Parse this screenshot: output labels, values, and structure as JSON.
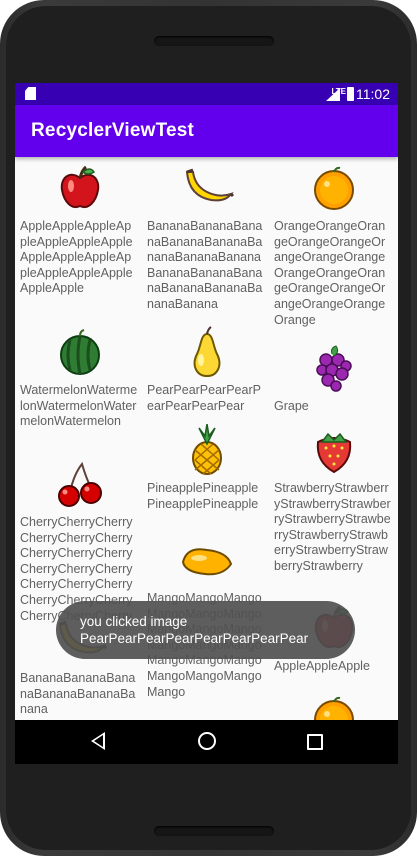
{
  "status_bar": {
    "time": "11:02",
    "network": "LTE"
  },
  "app_bar": {
    "title": "RecyclerViewTest"
  },
  "columns": [
    [
      {
        "fruit": "apple",
        "name": "AppleAppleAppleAppleAppleAppleAppleAppleAppleAppleAppleAppleAppleAppleAppleApple"
      },
      {
        "fruit": "watermelon",
        "name": "WatermelonWatermelonWatermelonWatermelonWatermelon"
      },
      {
        "fruit": "cherry",
        "name": "CherryCherryCherryCherryCherryCherryCherryCherryCherryCherryCherryCherryCherryCherryCherryCherryCherryCherryCherryCherryCherry"
      },
      {
        "fruit": "banana",
        "name": "BananaBananaBananaBananaBananaBanana"
      }
    ],
    [
      {
        "fruit": "banana",
        "name": "BananaBananaBananaBananaBananaBananaBananaBananaBananaBananaBananaBananaBananaBananaBanana"
      },
      {
        "fruit": "pear",
        "name": "PearPearPearPearPearPearPearPear"
      },
      {
        "fruit": "pineapple",
        "name": "PineapplePineapplePineapplePineapple"
      },
      {
        "fruit": "mango",
        "name": "MangoMangoMangoMangoMangoMangoMangoMangoMangoMangoMangoMangoMangoMangoMangoMangoMangoMangoMango"
      }
    ],
    [
      {
        "fruit": "orange",
        "name": "OrangeOrangeOrangeOrangeOrangeOrangeOrangeOrangeOrangeOrangeOrangeOrangeOrangeOrangeOrangeOrangeOrange"
      },
      {
        "fruit": "grape",
        "name": "Grape"
      },
      {
        "fruit": "strawberry",
        "name": "StrawberryStrawberryStrawberryStrawberryStrawberryStrawberryStrawberryStrawberryStrawberryStrawberryStrawberry"
      },
      {
        "fruit": "apple",
        "name": "AppleAppleApple"
      },
      {
        "fruit": "orange",
        "name": ""
      }
    ]
  ],
  "toast": {
    "line1": "you clicked image",
    "line2": "PearPearPearPearPearPearPearPear"
  },
  "colors": {
    "status_bar": "#3700b3",
    "app_bar": "#6200ee",
    "toast": "#505050"
  }
}
